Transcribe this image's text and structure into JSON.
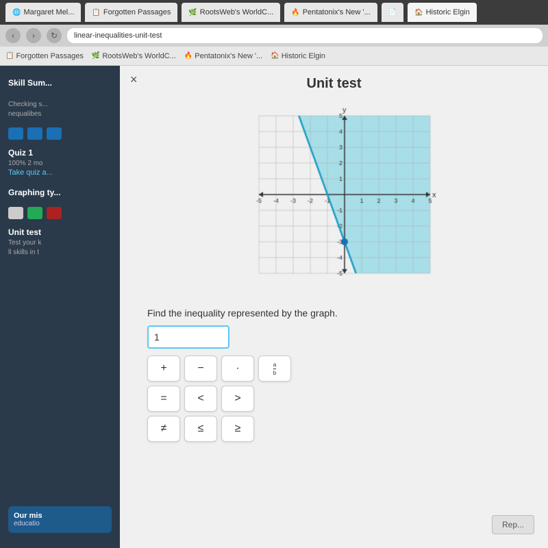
{
  "browser": {
    "tabs": [
      {
        "label": "Margaret Mel...",
        "icon": "🌐",
        "active": false
      },
      {
        "label": "Forgotten Passages",
        "icon": "📋",
        "active": false
      },
      {
        "label": "RootsWeb's WorldC...",
        "icon": "🌿",
        "active": false
      },
      {
        "label": "Pentatonix's New '...",
        "icon": "🔥",
        "active": false
      },
      {
        "label": "",
        "icon": "📄",
        "active": false
      },
      {
        "label": "Historic Elgin",
        "icon": "🏠",
        "active": true
      }
    ],
    "url": "linear-inequalities-unit-test",
    "bookmarks": [
      {
        "label": "Forgotten Passages",
        "icon": "📋"
      },
      {
        "label": "RootsWeb's WorldC...",
        "icon": "🌿"
      },
      {
        "label": "Pentatonix's New '...",
        "icon": "🔥"
      },
      {
        "label": "Historic Elgin",
        "icon": "🏠"
      }
    ]
  },
  "sidebar": {
    "skill_summary_label": "Skill Sum...",
    "checking_label": "Checking s...",
    "inequalities_label": "nequalibes",
    "quiz_label": "Quiz 1",
    "quiz_score": "100% 2 mo",
    "quiz_link": "Take quiz a...",
    "graphing_label": "Graphing ty...",
    "unit_test_label": "Unit test",
    "unit_test_desc1": "Test your k",
    "unit_test_desc2": "ll skills in t",
    "our_mission_label": "Our mis",
    "education_label": "educatio"
  },
  "content": {
    "title": "Unit test",
    "close_label": "×",
    "question_text": "Find the inequality represented by the graph.",
    "answer_value": "1",
    "answer_placeholder": "",
    "keys_row1": [
      "+",
      "-",
      ".",
      "⊞"
    ],
    "keys_row2": [
      "=",
      "<",
      ">"
    ],
    "keys_row3": [
      "≠",
      "<",
      ">"
    ],
    "reply_label": "Rep..."
  },
  "graph": {
    "x_min": -5,
    "x_max": 5,
    "y_min": -5,
    "y_max": 5,
    "shaded_color": "rgba(100, 200, 220, 0.5)",
    "line_color": "#1a9cc4",
    "line_point": {
      "x": 0,
      "y": -3
    },
    "line_slope": -3
  }
}
